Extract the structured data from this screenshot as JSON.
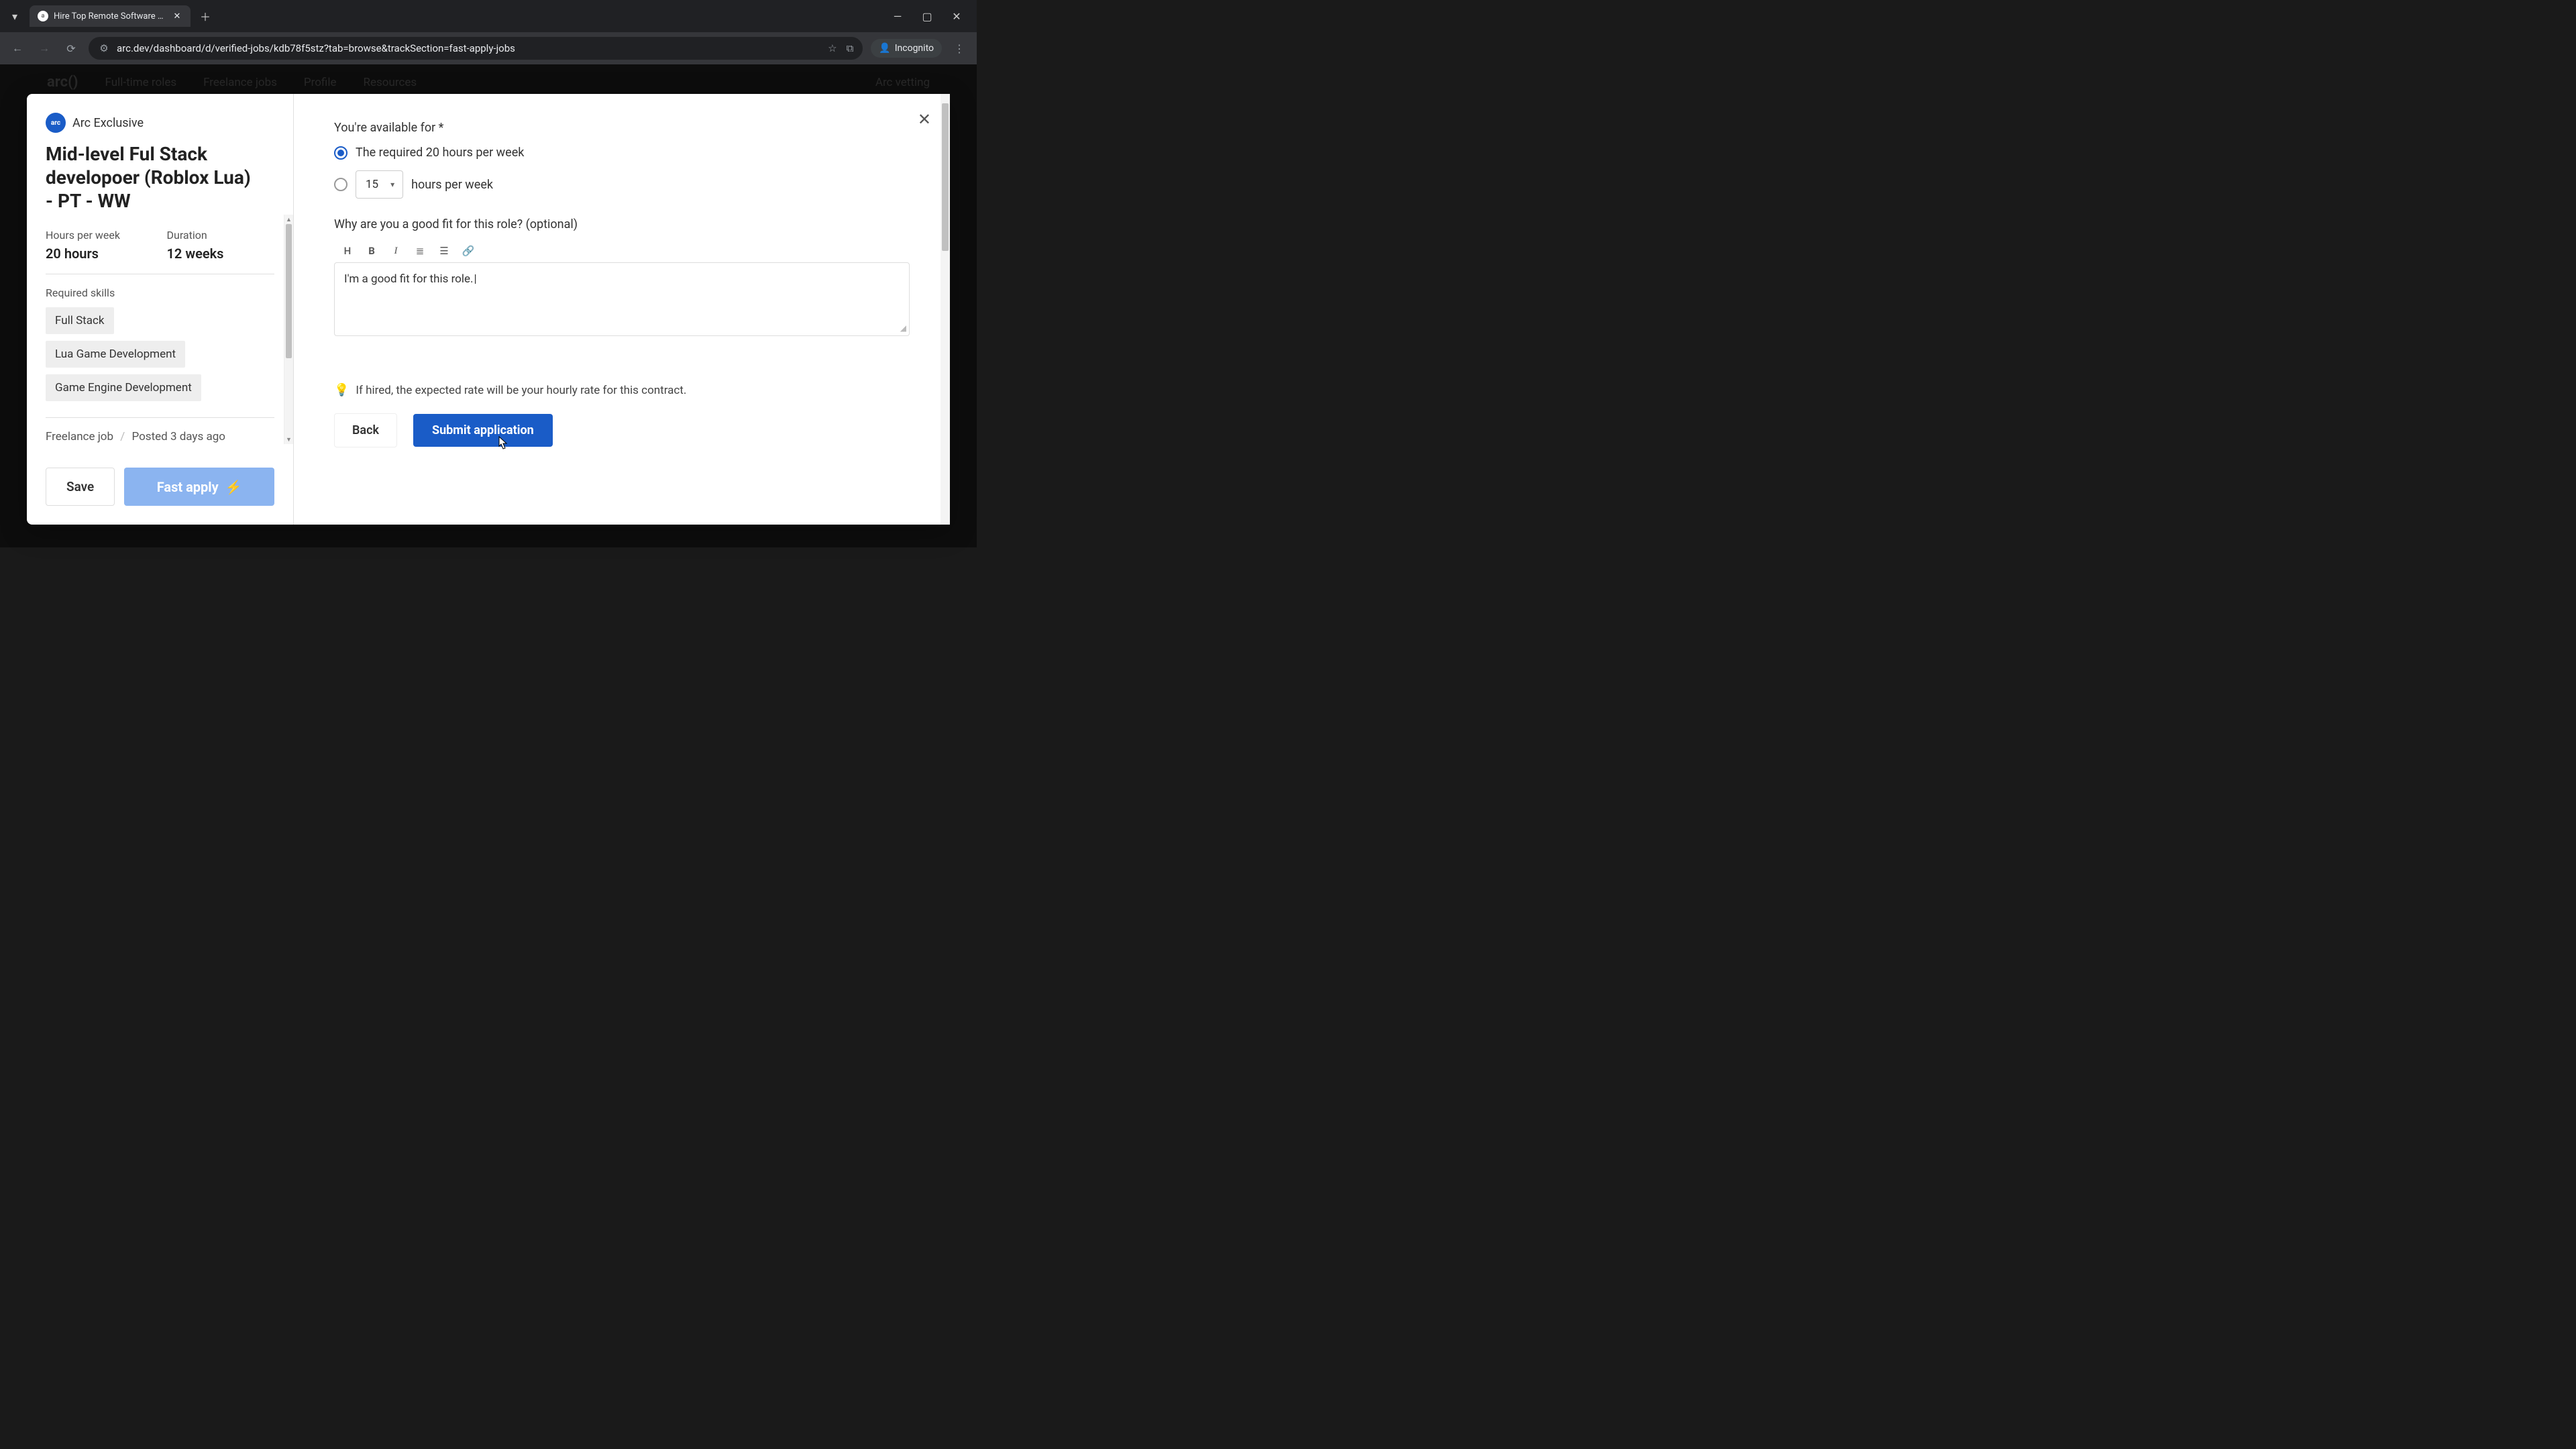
{
  "browser": {
    "tab_title": "Hire Top Remote Software Dev…",
    "url": "arc.dev/dashboard/d/verified-jobs/kdb78f5stz?tab=browse&trackSection=fast-apply-jobs",
    "incognito_label": "Incognito"
  },
  "bg_nav": {
    "logo": "arc()",
    "items": [
      "Full-time roles",
      "Freelance jobs",
      "Profile",
      "Resources"
    ],
    "right": "Arc vetting"
  },
  "job": {
    "badge": "arc()",
    "exclusive": "Arc Exclusive",
    "title": "Mid-level Ful Stack developoer (Roblox Lua) - PT - WW",
    "hours_label": "Hours per week",
    "hours_value": "20 hours",
    "duration_label": "Duration",
    "duration_value": "12 weeks",
    "skills_label": "Required skills",
    "skills": [
      "Full Stack",
      "Lua Game Development",
      "Game Engine Development"
    ],
    "type": "Freelance job",
    "posted": "Posted 3 days ago",
    "save_btn": "Save",
    "fast_apply_btn": "Fast apply"
  },
  "form": {
    "available_label": "You're available for *",
    "radio_required": "The required 20 hours per week",
    "hours_select_value": "15",
    "hours_suffix": "hours per week",
    "fit_label": "Why are you a good fit for this role? (optional)",
    "fit_value": "I'm a good fit for this role.",
    "hint": "If hired, the expected rate will be your hourly rate for this contract.",
    "back_btn": "Back",
    "submit_btn": "Submit application"
  }
}
